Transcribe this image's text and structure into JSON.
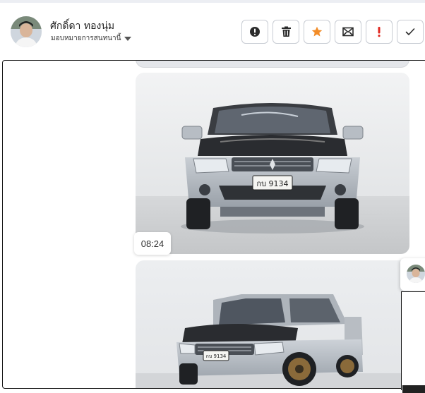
{
  "header": {
    "contact_name": "ศักดิ์ดา ทองนุ่ม",
    "assign_label": "มอบหมายการสนทนานี้"
  },
  "actions": [
    {
      "name": "alert-button",
      "icon": "exclamation-circle-icon",
      "color": "#333333"
    },
    {
      "name": "delete-button",
      "icon": "trash-icon",
      "color": "#333333"
    },
    {
      "name": "star-button",
      "icon": "star-icon",
      "color": "#f28c28"
    },
    {
      "name": "mark-unread-button",
      "icon": "envelope-x-icon",
      "color": "#333333"
    },
    {
      "name": "important-button",
      "icon": "exclamation-icon",
      "color": "#e0271f"
    },
    {
      "name": "resolve-button",
      "icon": "check-icon",
      "color": "#333333"
    }
  ],
  "messages": [
    {
      "type": "image",
      "subject": "silver pickup truck front view",
      "plate": "กบ 9134",
      "time": "08:24"
    },
    {
      "type": "image",
      "subject": "silver pickup truck three-quarter view",
      "plate": "กบ 9134"
    }
  ]
}
